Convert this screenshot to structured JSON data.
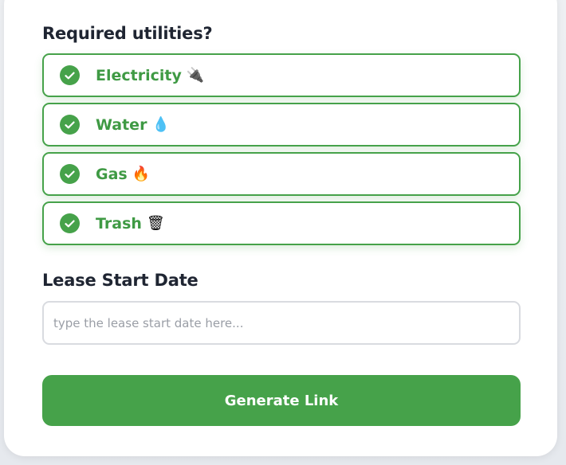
{
  "utilities": {
    "title": "Required utilities?",
    "accent_color": "#46a24a",
    "items": [
      {
        "label": "Electricity",
        "emoji": "🔌",
        "checked": true,
        "icon": "plug-icon"
      },
      {
        "label": "Water",
        "emoji": "💧",
        "checked": true,
        "icon": "droplet-icon"
      },
      {
        "label": "Gas",
        "emoji": "🔥",
        "checked": true,
        "icon": "fire-icon"
      },
      {
        "label": "Trash",
        "emoji": "🗑",
        "checked": true,
        "icon": "wastebasket-icon"
      }
    ]
  },
  "lease": {
    "title": "Lease Start Date",
    "placeholder": "type the lease start date here...",
    "value": ""
  },
  "actions": {
    "generate_label": "Generate Link"
  }
}
